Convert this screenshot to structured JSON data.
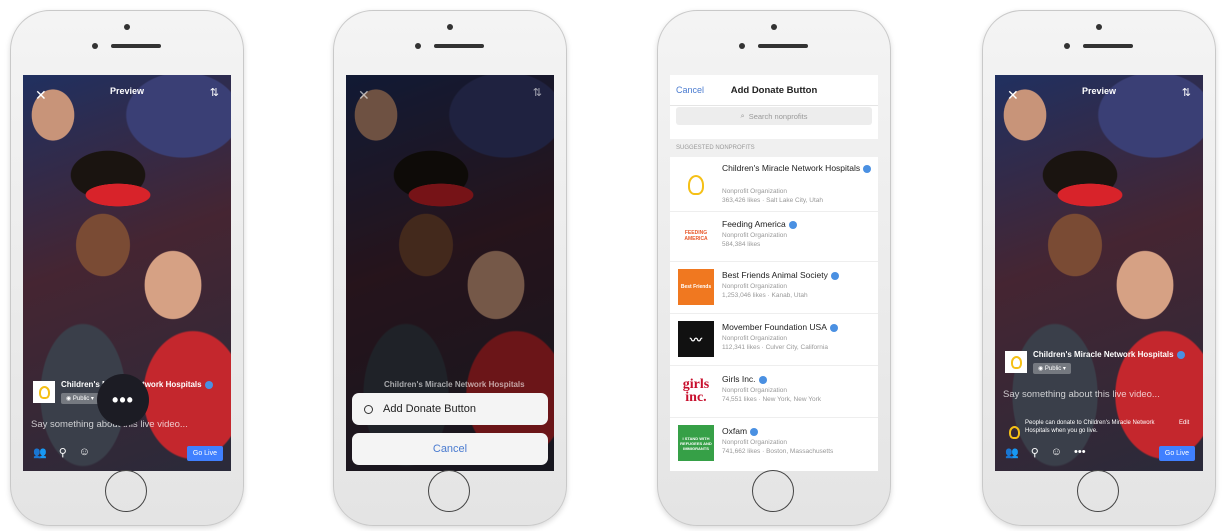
{
  "preview": {
    "title": "Preview"
  },
  "org_name": "Children's Miracle Network Hospitals",
  "audience": "Public",
  "compose_placeholder": "Say something about this live video...",
  "go_live": "Go Live",
  "more_glyph": "•••",
  "action_sheet": {
    "add_donate": "Add Donate Button",
    "cancel": "Cancel"
  },
  "picker": {
    "cancel": "Cancel",
    "title": "Add Donate Button",
    "search_placeholder": "Search nonprofits",
    "section": "SUGGESTED NONPROFITS",
    "items": [
      {
        "name": "Children's Miracle Network Hospitals",
        "type": "Nonprofit Organization",
        "meta": "363,426 likes · Salt Lake City, Utah",
        "logo_text": ""
      },
      {
        "name": "Feeding America",
        "type": "Nonprofit Organization",
        "meta": "584,384 likes",
        "logo_text": "FEEDING AMERICA"
      },
      {
        "name": "Best Friends Animal Society",
        "type": "Nonprofit Organization",
        "meta": "1,253,046 likes · Kanab, Utah",
        "logo_text": "Best Friends"
      },
      {
        "name": "Movember Foundation USA",
        "type": "Nonprofit Organization",
        "meta": "112,341 likes · Culver City, California",
        "logo_text": ""
      },
      {
        "name": "Girls Inc.",
        "type": "Nonprofit Organization",
        "meta": "74,551 likes · New York, New York",
        "logo_text": "girls inc."
      },
      {
        "name": "Oxfam",
        "type": "Nonprofit Organization",
        "meta": "741,662 likes · Boston, Massachusetts",
        "logo_text": "I STAND WITH REFUGEES AND IMMIGRANTS"
      }
    ]
  },
  "donate_notice": "People can donate to Children's Miracle Network Hospitals when you go live.",
  "edit": "Edit",
  "colors": {
    "accent": "#4080ff",
    "link": "#4a7bd0",
    "verified": "#4a90e2",
    "bulb": "#f5c016"
  }
}
